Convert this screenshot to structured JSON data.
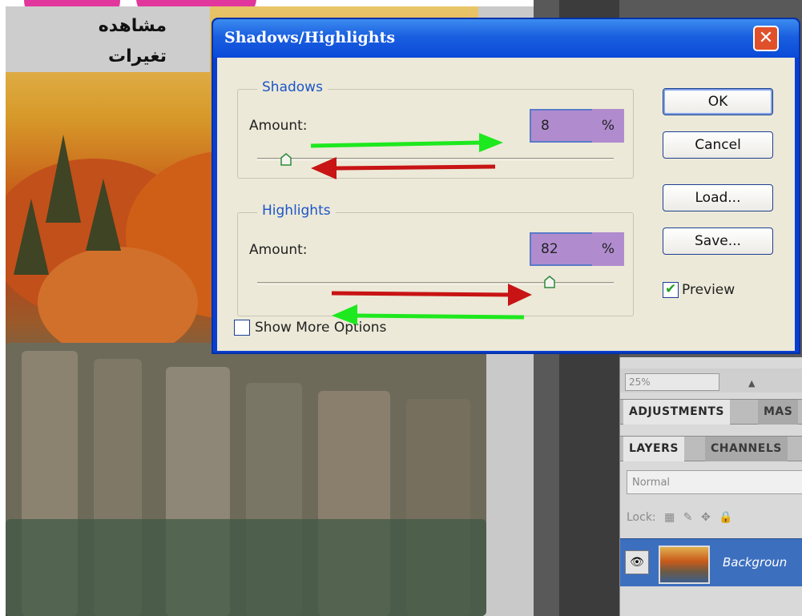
{
  "background": {
    "caption_line1": "مشاهده",
    "caption_line2": "تغيرات"
  },
  "panels": {
    "zoom": "25%",
    "adjustments_tabs": [
      "ADJUSTMENTS",
      "MAS"
    ],
    "layer_tabs": [
      "LAYERS",
      "CHANNELS"
    ],
    "blend_mode": "Normal",
    "lock_label": "Lock:",
    "layer_name": "Backgroun"
  },
  "dialog": {
    "title": "Shadows/Highlights",
    "shadows": {
      "group_label": "Shadows",
      "amount_label": "Amount:",
      "amount_value": "8",
      "unit": "%",
      "slider_value_percent": 8
    },
    "highlights": {
      "group_label": "Highlights",
      "amount_label": "Amount:",
      "amount_value": "82",
      "unit": "%",
      "slider_value_percent": 82
    },
    "buttons": {
      "ok": "OK",
      "cancel": "Cancel",
      "load": "Load...",
      "save": "Save..."
    },
    "preview_label": "Preview",
    "preview_checked": true,
    "more_options_label": "Show More Options",
    "more_options_checked": false
  },
  "colors": {
    "titlebar": "#0a4ad8",
    "field_highlight": "#b08ccf",
    "arrow_green": "#1ee81e",
    "arrow_red": "#c81414"
  }
}
